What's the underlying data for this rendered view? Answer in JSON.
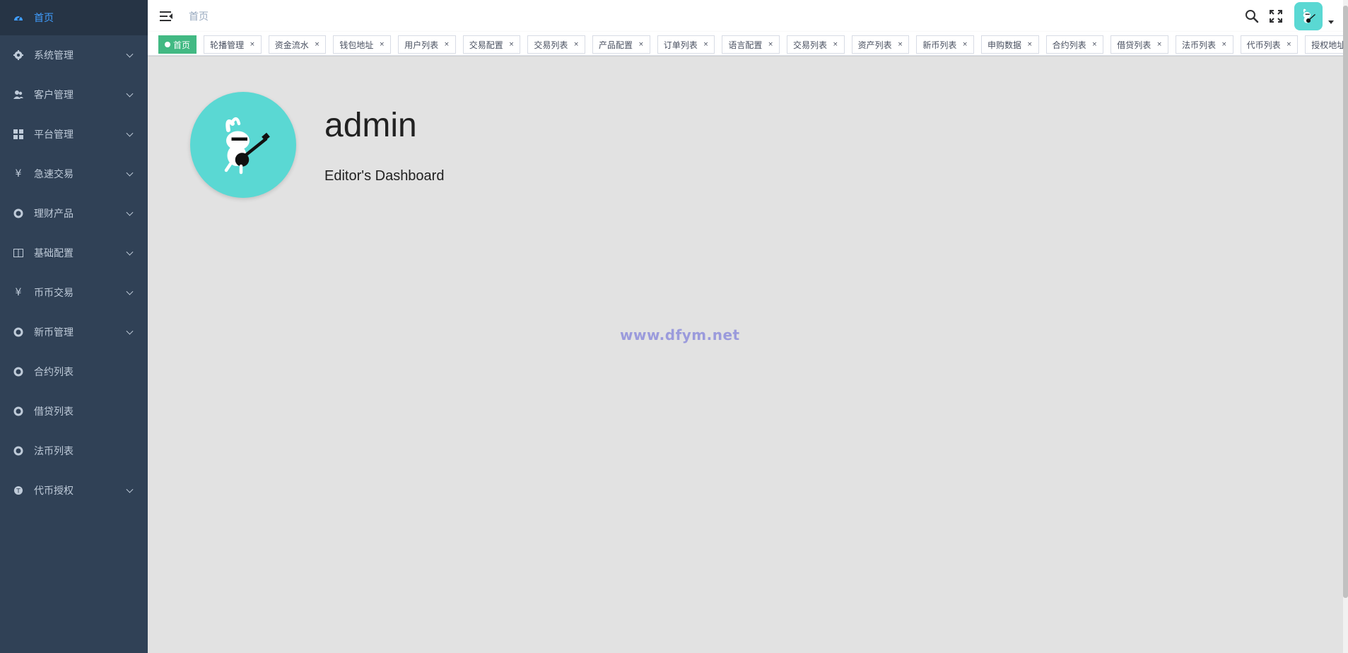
{
  "sidebar": {
    "items": [
      {
        "label": "首页",
        "icon": "dashboard-icon"
      },
      {
        "label": "系统管理",
        "icon": "gear-icon"
      },
      {
        "label": "客户管理",
        "icon": "users-icon"
      },
      {
        "label": "平台管理",
        "icon": "grid-icon"
      },
      {
        "label": "急速交易",
        "icon": "yen-icon"
      },
      {
        "label": "理财产品",
        "icon": "lifebuoy-icon"
      },
      {
        "label": "基础配置",
        "icon": "book-icon"
      },
      {
        "label": "币币交易",
        "icon": "yen-icon"
      },
      {
        "label": "新币管理",
        "icon": "lifebuoy-icon"
      },
      {
        "label": "合约列表",
        "icon": "lifebuoy-icon"
      },
      {
        "label": "借贷列表",
        "icon": "lifebuoy-icon"
      },
      {
        "label": "法币列表",
        "icon": "lifebuoy-icon"
      },
      {
        "label": "代币授权",
        "icon": "token-icon"
      }
    ]
  },
  "navbar": {
    "breadcrumb": "首页"
  },
  "tags": {
    "active": "首页",
    "items": [
      "轮播管理",
      "资金流水",
      "钱包地址",
      "用户列表",
      "交易配置",
      "交易列表",
      "产品配置",
      "订单列表",
      "语言配置",
      "交易列表",
      "资产列表",
      "新币列表",
      "申购数据",
      "合约列表",
      "借贷列表",
      "法币列表",
      "代币列表",
      "授权地址"
    ],
    "close_glyph": "×"
  },
  "dashboard": {
    "name": "admin",
    "role": "Editor's Dashboard"
  },
  "watermark": "www.dfym.net",
  "colors": {
    "sidebar_bg": "#304156",
    "accent": "#409eff",
    "tag_active": "#42b983",
    "avatar_bg": "#5ad8d3"
  }
}
